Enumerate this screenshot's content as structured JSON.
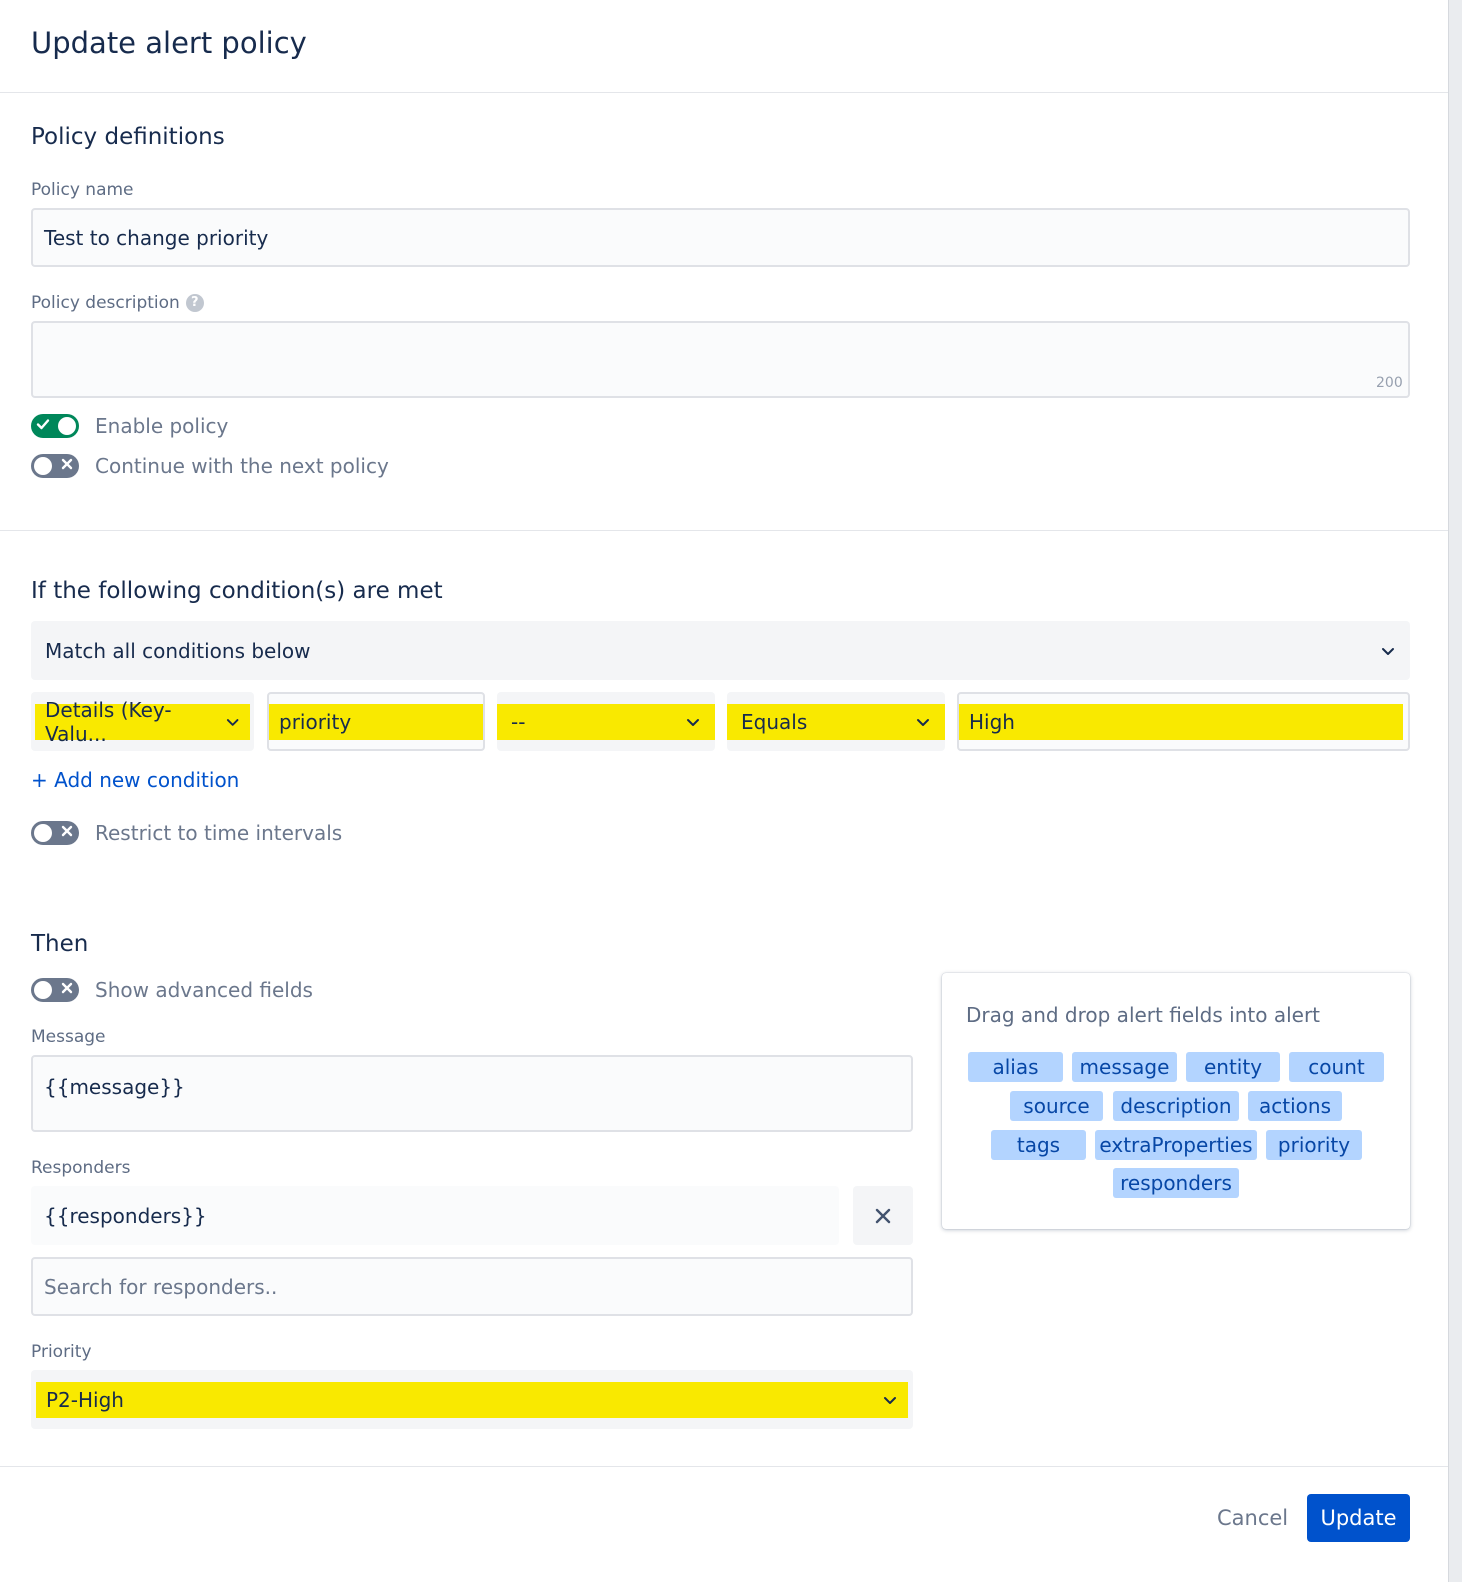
{
  "dialog": {
    "title": "Update alert policy"
  },
  "definitions": {
    "title": "Policy definitions",
    "name_label": "Policy name",
    "name_value": "Test to change priority",
    "description_label": "Policy description",
    "help_glyph": "?",
    "description_value": "",
    "description_counter": "200",
    "enable_label": "Enable policy",
    "enable_on": true,
    "continue_label": "Continue with the next policy",
    "continue_on": false
  },
  "conditions": {
    "title": "If the following condition(s) are met",
    "match_value": "Match all conditions below",
    "row": {
      "field": "Details (Key-Valu...",
      "key": "priority",
      "operator_modifier": "--",
      "operator": "Equals",
      "value": "High"
    },
    "add_label": "+ Add new condition",
    "restrict_label": "Restrict to time intervals",
    "restrict_on": false
  },
  "then": {
    "title": "Then",
    "advanced_label": "Show advanced fields",
    "advanced_on": false,
    "message_label": "Message",
    "message_value": "{{message}}",
    "responders_label": "Responders",
    "responders_value": "{{responders}}",
    "responders_search_placeholder": "Search for responders..",
    "priority_label": "Priority",
    "priority_value": "P2-High"
  },
  "fields_panel": {
    "title": "Drag and drop alert fields into alert",
    "chips": [
      "alias",
      "message",
      "entity",
      "count",
      "source",
      "description",
      "actions",
      "tags",
      "extraProperties",
      "priority",
      "responders"
    ]
  },
  "footer": {
    "cancel_label": "Cancel",
    "update_label": "Update"
  },
  "colors": {
    "primary": "#0052cc",
    "toggle_on": "#00875a",
    "toggle_off": "#6b778c",
    "highlight": "#f9e900",
    "chip": "#b3d4ff"
  },
  "icons": {
    "close": "close-icon",
    "check": "check-icon",
    "cross": "cross-icon",
    "chevron": "chevron-down-icon",
    "help": "help-icon"
  }
}
